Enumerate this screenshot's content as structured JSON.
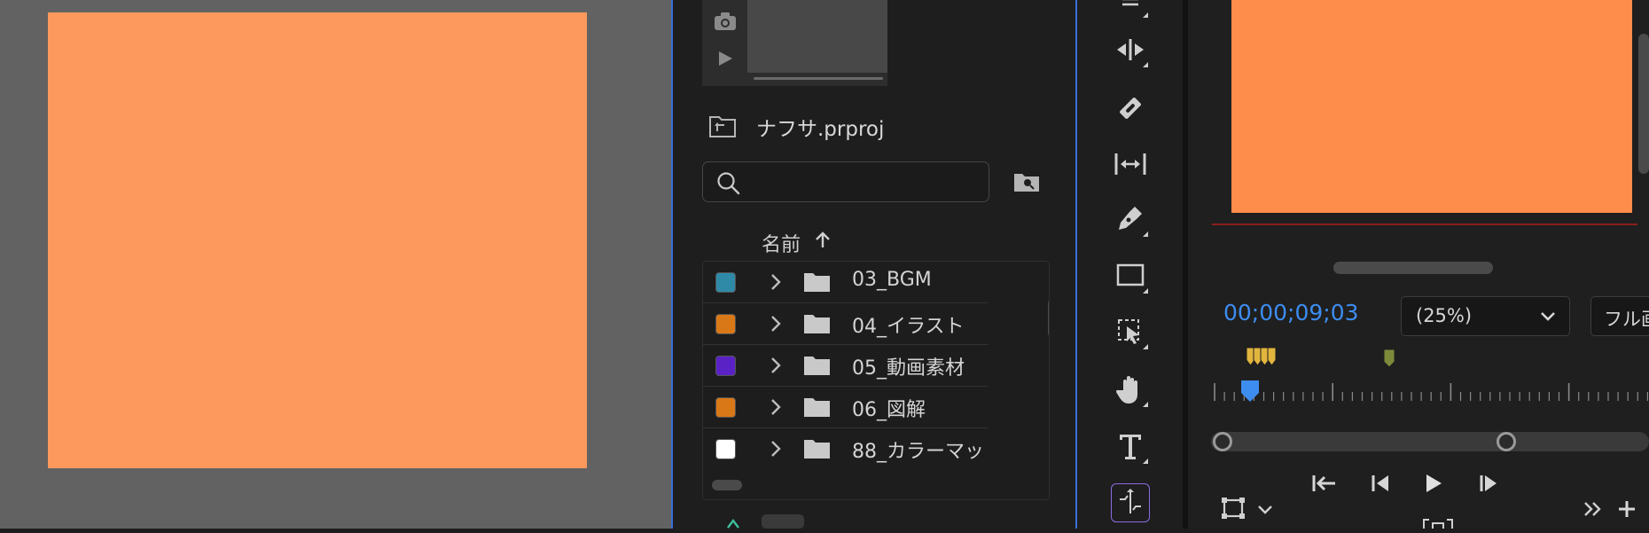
{
  "project": {
    "file_name": "ナフサ.prproj",
    "search": {
      "value": "",
      "placeholder": ""
    },
    "name_column_header": "名前",
    "bins": [
      {
        "label": "03_BGM",
        "color": "#2f8aa8"
      },
      {
        "label": "04_イラスト",
        "color": "#d97817"
      },
      {
        "label": "05_動画素材",
        "color": "#5a22c4"
      },
      {
        "label": "06_図解",
        "color": "#d97817"
      },
      {
        "label": "88_カラーマッ",
        "color": "#ffffff"
      }
    ]
  },
  "toolbar": {
    "tools": [
      "more-tools-icon",
      "ripple-edit-icon",
      "razor-icon",
      "slip-icon",
      "pen-icon",
      "rectangle-icon",
      "track-select-icon",
      "hand-icon",
      "type-icon",
      "remix-icon"
    ]
  },
  "program": {
    "timecode": "00;00;09;03",
    "zoom_level": "(25%)",
    "quality": "フル画質",
    "accent_color": "#3d8cf0",
    "frame_color": "#fe8c4a"
  },
  "source_frame_color": "#fe995e"
}
